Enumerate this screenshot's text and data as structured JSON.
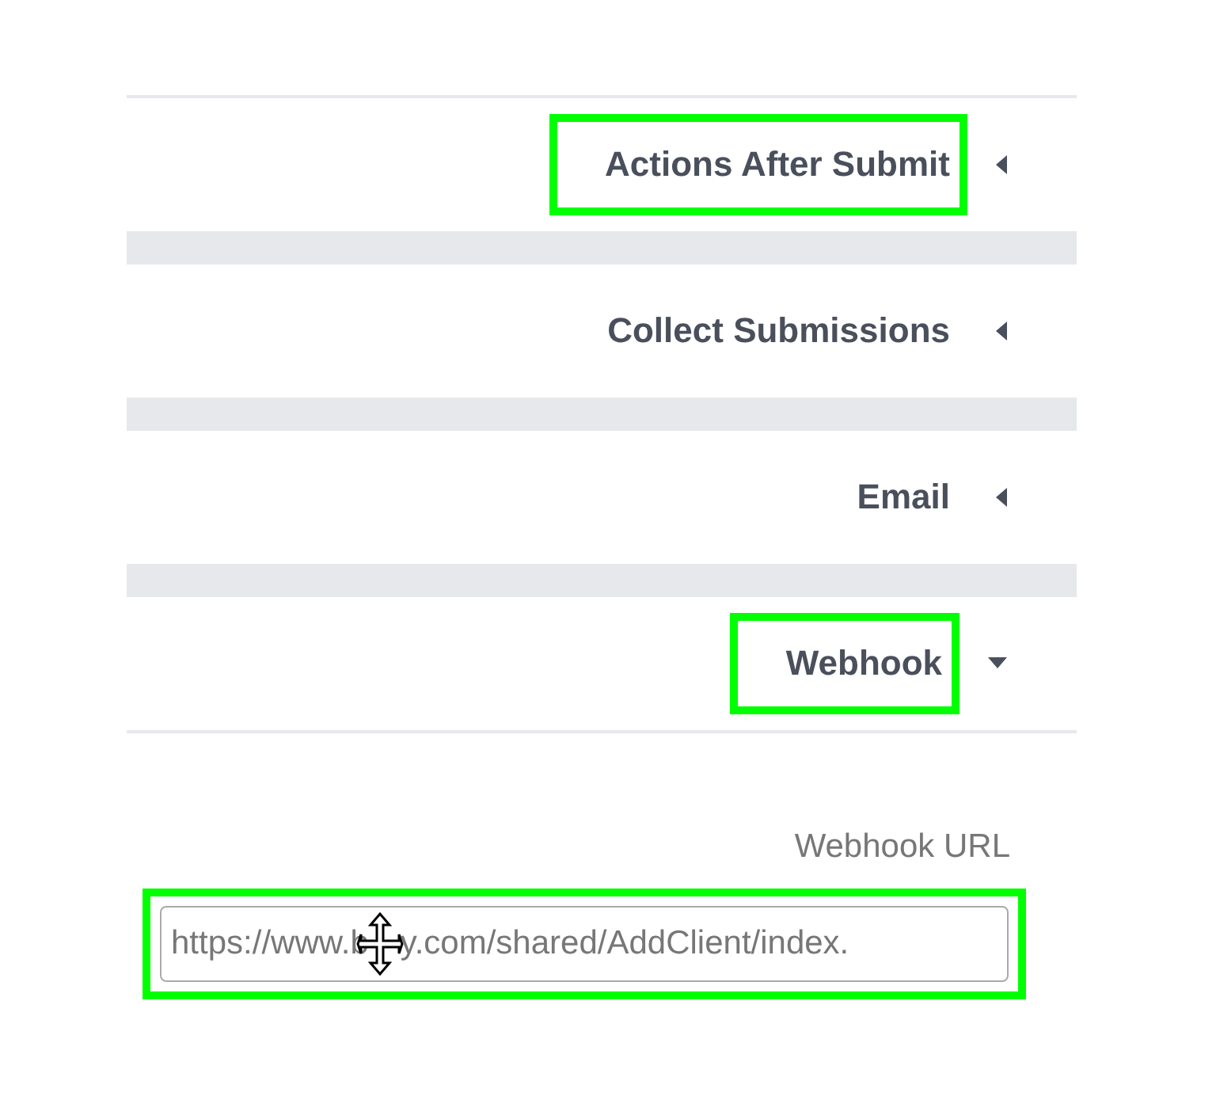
{
  "sections": [
    {
      "title": "Actions After Submit",
      "expanded": false,
      "highlighted": true
    },
    {
      "title": "Collect Submissions",
      "expanded": false,
      "highlighted": false
    },
    {
      "title": "Email",
      "expanded": false,
      "highlighted": false
    },
    {
      "title": "Webhook",
      "expanded": true,
      "highlighted": true
    }
  ],
  "webhook_url": {
    "label": "Webhook URL",
    "value_parts": [
      "https://www.b",
      "y.com/shared/AddClient/index."
    ],
    "highlighted": true
  }
}
